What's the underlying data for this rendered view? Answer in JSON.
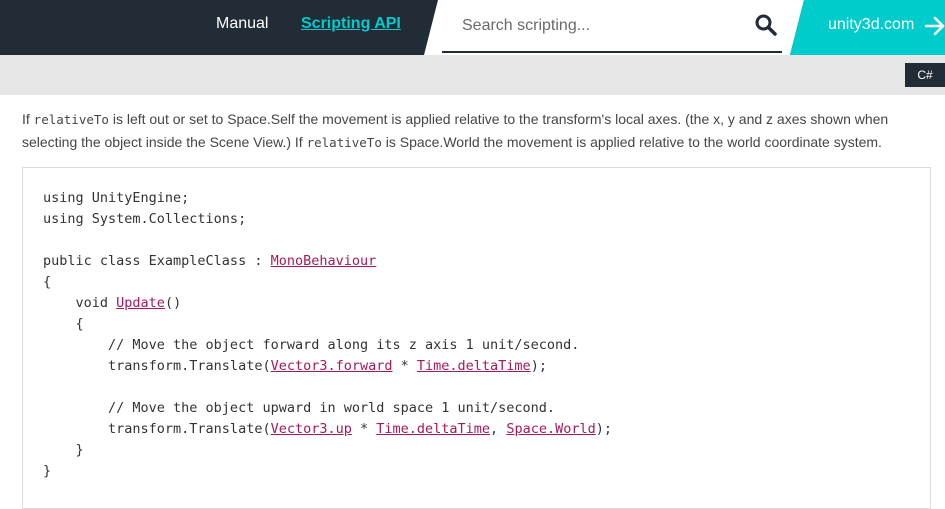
{
  "header": {
    "nav": {
      "manual": "Manual",
      "scripting_api": "Scripting API"
    },
    "search": {
      "placeholder": "Search scripting..."
    },
    "unity_link": "unity3d.com"
  },
  "language": {
    "selected": "C#"
  },
  "description": {
    "p1_before": "If ",
    "code1": "relativeTo",
    "p1_mid": " is left out or set to Space.Self the movement is applied relative to the transform's local axes. (the x, y and z axes shown when selecting the object inside the Scene View.) If ",
    "code2": "relativeTo",
    "p1_after": " is Space.World the movement is applied relative to the world coordinate system."
  },
  "code": {
    "l1": "using UnityEngine;",
    "l2": "using System.Collections;",
    "l4_pre": "public class ExampleClass : ",
    "l4_link": "MonoBehaviour",
    "l5": "{",
    "l6_pre": "    void ",
    "l6_link": "Update",
    "l6_post": "()",
    "l7": "    {",
    "l8": "        // Move the object forward along its z axis 1 unit/second.",
    "l9_pre": "        transform.Translate(",
    "l9_link1": "Vector3.forward",
    "l9_mid": " * ",
    "l9_link2": "Time.deltaTime",
    "l9_post": ");",
    "l11": "        // Move the object upward in world space 1 unit/second.",
    "l12_pre": "        transform.Translate(",
    "l12_link1": "Vector3.up",
    "l12_mid1": " * ",
    "l12_link2": "Time.deltaTime",
    "l12_mid2": ", ",
    "l12_link3": "Space.World",
    "l12_post": ");",
    "l13": "    }",
    "l14": "}"
  },
  "icons": {
    "search": "search-icon",
    "arrow": "arrow-right-icon"
  },
  "colors": {
    "header": "#222c37",
    "accent": "#00cccc",
    "link": "#a6195b"
  }
}
